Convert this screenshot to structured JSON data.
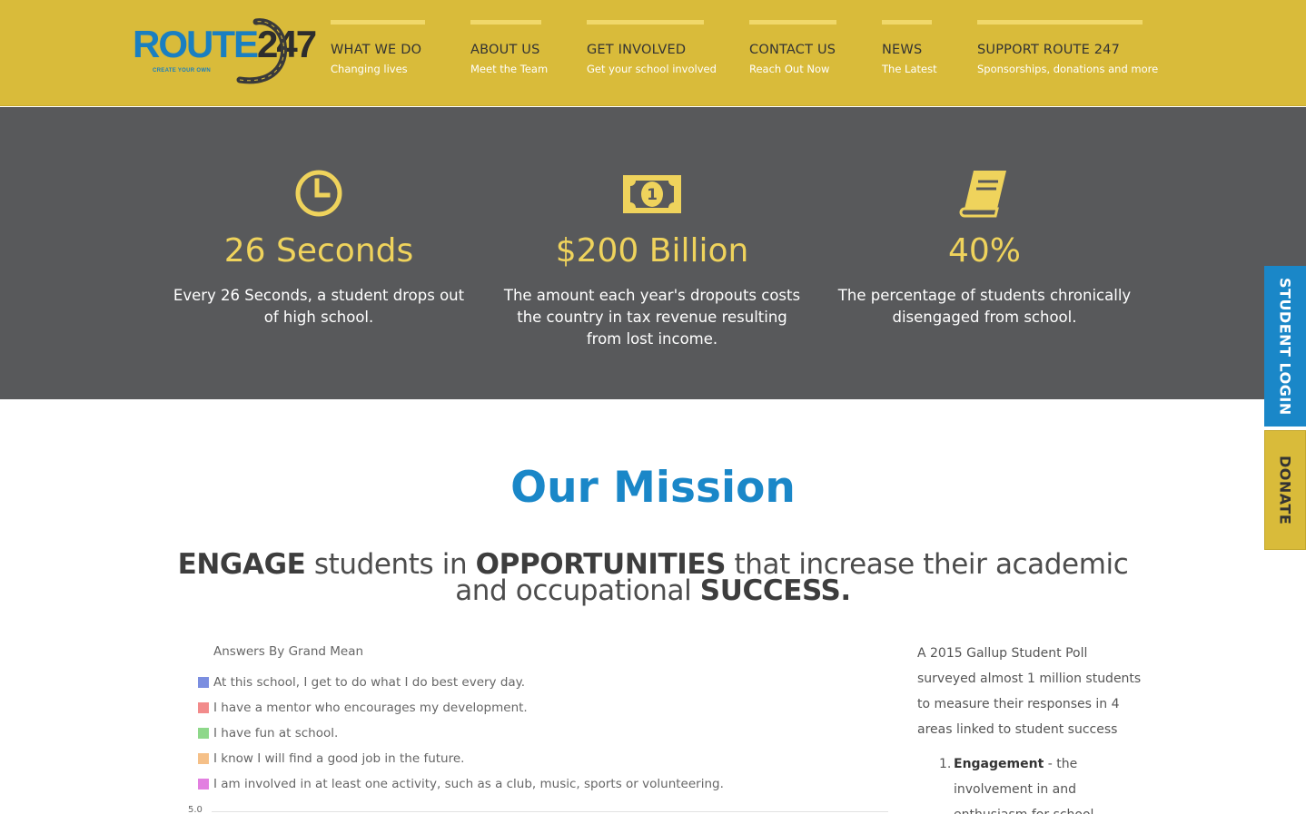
{
  "header": {
    "logo": {
      "main": "ROUTE",
      "number": "247",
      "tagline": "CREATE YOUR OWN"
    },
    "nav": [
      {
        "title": "WHAT WE DO",
        "subtitle": "Changing lives"
      },
      {
        "title": "ABOUT US",
        "subtitle": "Meet the Team"
      },
      {
        "title": "GET INVOLVED",
        "subtitle": "Get your school involved"
      },
      {
        "title": "CONTACT US",
        "subtitle": "Reach Out Now"
      },
      {
        "title": "NEWS",
        "subtitle": "The Latest"
      },
      {
        "title": "SUPPORT ROUTE 247",
        "subtitle": "Sponsorships, donations and more"
      }
    ]
  },
  "stats": [
    {
      "icon": "clock-icon",
      "value": "26 Seconds",
      "description": "Every 26 Seconds, a student drops out of high school."
    },
    {
      "icon": "dollar-bill-icon",
      "value": "$200 Billion",
      "description": "The amount each year's dropouts costs the country in tax revenue resulting from lost income."
    },
    {
      "icon": "book-icon",
      "value": "40%",
      "description": "The percentage of students chronically disengaged from school."
    }
  ],
  "side_tabs": {
    "student_login": "STUDENT LOGIN",
    "donate": "DONATE"
  },
  "mission": {
    "title": "Our Mission",
    "line": {
      "w1": "ENGAGE",
      "t1": " students in ",
      "w2": "OPPORTUNITIES",
      "t2": " that increase their academic and occupational ",
      "w3": "SUCCESS."
    }
  },
  "chart": {
    "heading": "Answers By Grand Mean",
    "legend": [
      {
        "label": "At this school, I get to do what I do best every day.",
        "color": "#7b8ee0"
      },
      {
        "label": "I have a mentor who encourages my development.",
        "color": "#f28b8b"
      },
      {
        "label": "I have fun at school.",
        "color": "#8ed88a"
      },
      {
        "label": "I know I will find a good job in the future.",
        "color": "#f5c088"
      },
      {
        "label": "I am involved in at least one activity, such as a club, music, sports or volunteering.",
        "color": "#e27fe0"
      }
    ],
    "axis_top": "5.0"
  },
  "poll": {
    "intro": "A 2015 Gallup Student Poll surveyed almost 1 million students to measure their responses in 4 areas linked to student success",
    "items": [
      {
        "number": "1.",
        "term": "Engagement",
        "text": " - the involvement in and enthusiasm for school"
      }
    ]
  },
  "colors": {
    "header": "#d9bb3a",
    "band": "#58595b",
    "accent_yellow": "#efd35c",
    "accent_blue": "#1a87c8"
  }
}
